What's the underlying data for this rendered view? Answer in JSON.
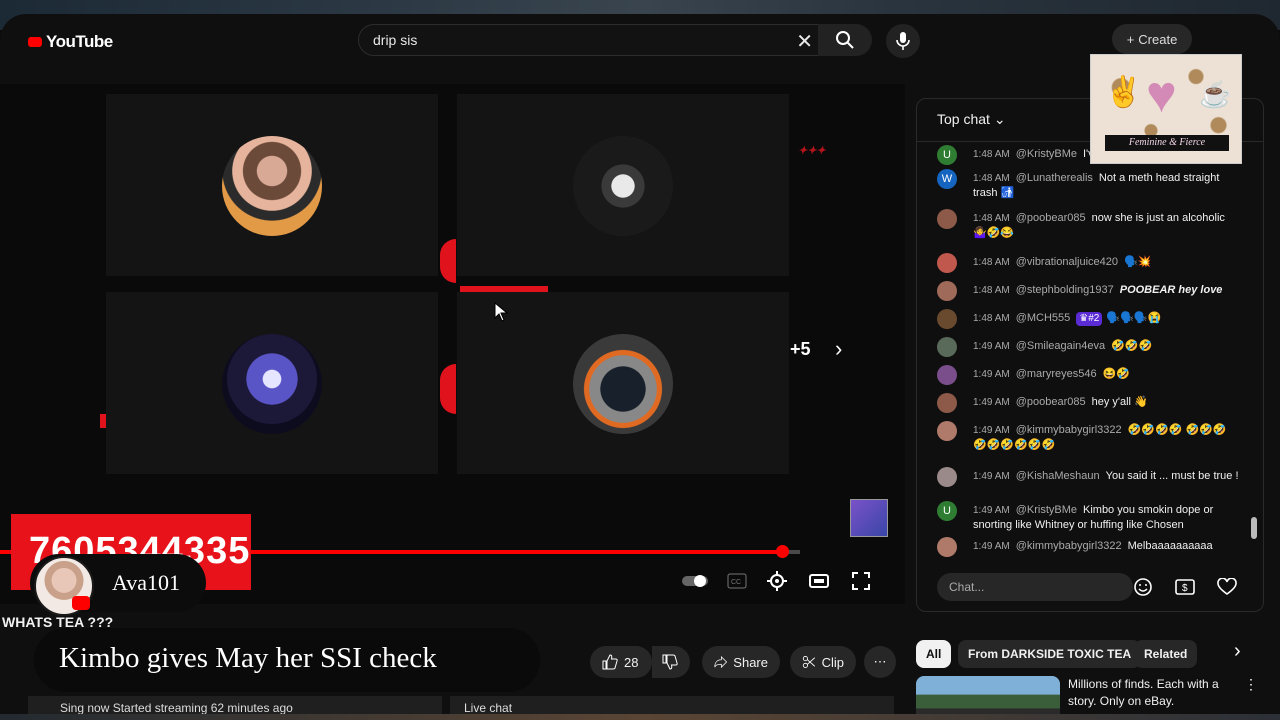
{
  "header": {
    "logo_text": "YouTube",
    "search_query": "drip sis",
    "create_label": "Create"
  },
  "player": {
    "more_participants": "+5",
    "phone_number": "7605344335",
    "brand_colors": {
      "accent": "#e0121b",
      "progress": "#ff0000"
    },
    "progress_fraction": 0.977
  },
  "overlay": {
    "uploader_name": "Ava101",
    "whats_tea": "WHATS TEA ???",
    "caption": "Kimbo gives May her SSI check"
  },
  "actions": {
    "like_count": "28",
    "share_label": "Share",
    "clip_label": "Clip",
    "more_label": "⋯",
    "below_left": "Sing now  Started streaming 62 minutes ago",
    "below_right": "Live chat"
  },
  "chat": {
    "header": "Top chat",
    "input_placeholder": "Chat...",
    "messages": [
      {
        "initial": "U",
        "color": "#2e7d32",
        "time": "1:48 AM",
        "author": "@KristyBMe",
        "text": "I'v"
      },
      {
        "initial": "W",
        "color": "#1565c0",
        "time": "1:48 AM",
        "author": "@Lunatherealis",
        "text": "Not a meth head straight trash 🚮"
      },
      {
        "initial": "",
        "color": "#8d5a4a",
        "time": "1:48 AM",
        "author": "@poobear085",
        "text": "now she is just an alcoholic 🤷‍♀️🤣😂"
      },
      {
        "initial": "",
        "color": "#c0584e",
        "time": "1:48 AM",
        "author": "@vibrationaljuice420",
        "text": "🗣️💥"
      },
      {
        "initial": "",
        "color": "#a06a5a",
        "time": "1:48 AM",
        "author": "@stephbolding1937",
        "text": "POOBEAR hey love"
      },
      {
        "initial": "",
        "color": "#6a4a2e",
        "time": "1:48 AM",
        "author": "@MCH555",
        "badge": "#2",
        "text": "🗣️🗣️🗣️😭"
      },
      {
        "initial": "",
        "color": "#5a6a5a",
        "time": "1:49 AM",
        "author": "@Smileagain4eva",
        "text": "🤣🤣🤣"
      },
      {
        "initial": "",
        "color": "#7a4e8a",
        "time": "1:49 AM",
        "author": "@maryreyes546",
        "text": "😆🤣"
      },
      {
        "initial": "",
        "color": "#8d5a4a",
        "time": "1:49 AM",
        "author": "@poobear085",
        "text": "hey y'all 👋"
      },
      {
        "initial": "",
        "color": "#b07a6a",
        "time": "1:49 AM",
        "author": "@kimmybabygirl3322",
        "text": "🤣🤣🤣🤣 🤣🤣🤣🤣🤣🤣🤣🤣🤣"
      },
      {
        "initial": "",
        "color": "#9a8a8a",
        "time": "1:49 AM",
        "author": "@KishaMeshaun",
        "text": "You said it ... must be true !"
      },
      {
        "initial": "U",
        "color": "#2e7d32",
        "time": "1:49 AM",
        "author": "@KristyBMe",
        "text": "Kimbo you smokin dope or snorting like Whitney or huffing like Chosen"
      },
      {
        "initial": "",
        "color": "#b07a6a",
        "time": "1:49 AM",
        "author": "@kimmybabygirl3322",
        "text": "Melbaaaaaaaaaa"
      }
    ]
  },
  "sticker": {
    "text": "Feminine & Fierce"
  },
  "related": {
    "chips": [
      "All",
      "From DARKSIDE TOXIC TEA",
      "Related"
    ],
    "ad_text": "Millions of finds. Each with a story. Only on eBay."
  },
  "icons": [
    "search-icon",
    "mic-icon",
    "close-icon",
    "chevron-right-icon",
    "settings-icon",
    "fullscreen-icon",
    "like-icon",
    "dislike-icon",
    "share-icon",
    "clip-icon",
    "emoji-icon",
    "heart-icon"
  ]
}
